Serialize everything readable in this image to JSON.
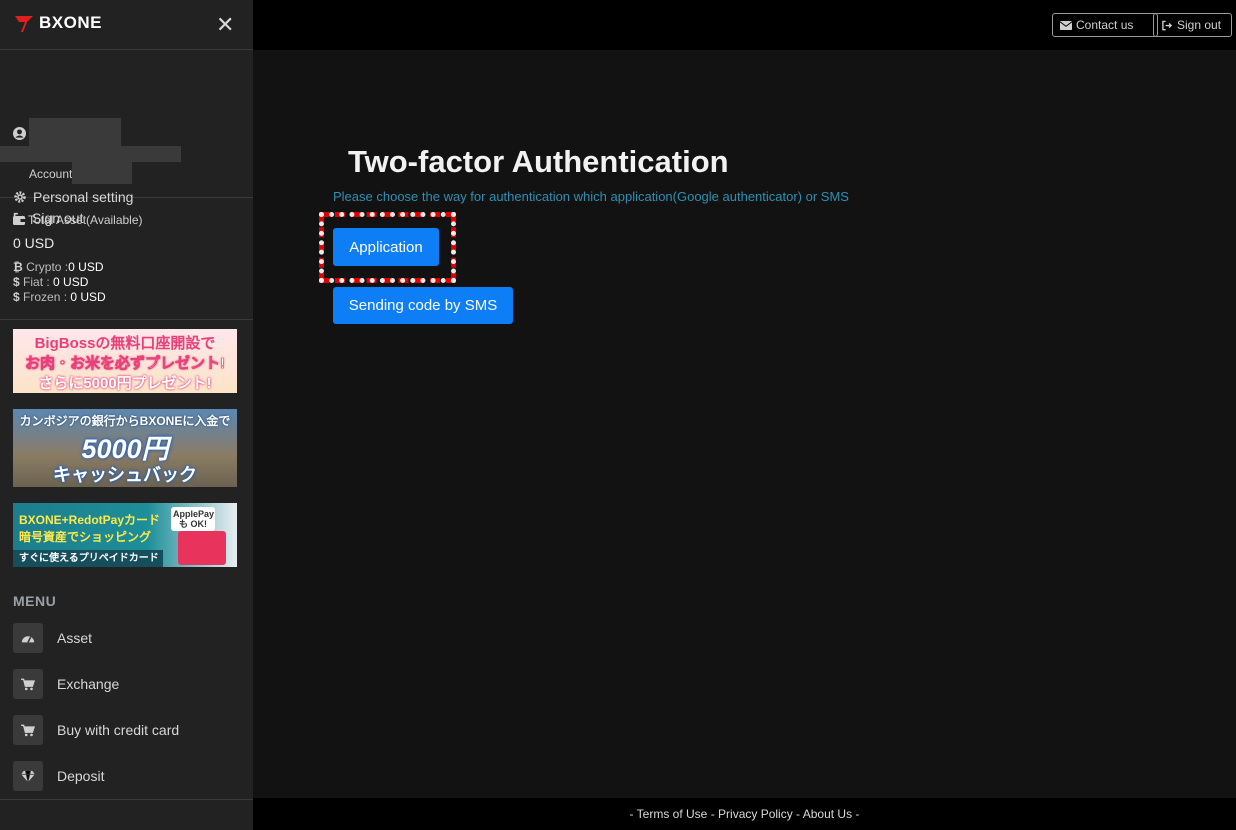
{
  "brand": {
    "name": "BXONE"
  },
  "sidebar": {
    "account_label": "Account:",
    "user_menu": [
      {
        "label": "Personal setting",
        "icon": "gear-icon"
      },
      {
        "label": "Sign out",
        "icon": "sign-out-icon"
      }
    ],
    "assets": {
      "title": "Total Asset(Available)",
      "total": "0 USD",
      "crypto_label": "Crypto :",
      "crypto_value": "0 USD",
      "fiat_label": "Fiat :",
      "fiat_value": " 0 USD",
      "frozen_label": "Frozen :",
      "frozen_value": " 0 USD"
    },
    "banners": [
      {
        "line1": "BigBossの無料口座開設で",
        "line2": "お肉・お米を必ずプレゼント!",
        "line3": "さらに5000円プレゼント!"
      },
      {
        "line1": "カンボジアの銀行からBXONEに入金で",
        "line2": "5000円",
        "line3": "キャッシュバック"
      },
      {
        "line1": "BXONE+RedotPayカード",
        "line2": "暗号資産でショッピング",
        "line3": "すぐに使えるプリペイドカード",
        "tag": "ApplePayも OK!"
      }
    ],
    "menu_header": "MENU",
    "nav": [
      {
        "label": "Asset",
        "icon": "dashboard-icon"
      },
      {
        "label": "Exchange",
        "icon": "cart-icon"
      },
      {
        "label": "Buy with credit card",
        "icon": "cart-icon"
      },
      {
        "label": "Deposit",
        "icon": "diamond-icon"
      }
    ]
  },
  "topbar": {
    "contact_label": "Contact us",
    "signout_label": "Sign out"
  },
  "main": {
    "title": "Two-factor Authentication",
    "subtitle": "Please choose the way for authentication which application(Google authenticator) or SMS",
    "btn_application": "Application",
    "btn_sms": "Sending code by SMS"
  },
  "footer": {
    "prefix": "- ",
    "terms": "Terms of Use",
    "sep1": " - ",
    "privacy": "Privacy Policy",
    "sep2": " - ",
    "about": "About Us",
    "suffix": " -"
  },
  "colors": {
    "accent_button": "#0d7ef6",
    "subtitle_text": "#2f8fb2",
    "highlight_ring": "#e00000"
  }
}
